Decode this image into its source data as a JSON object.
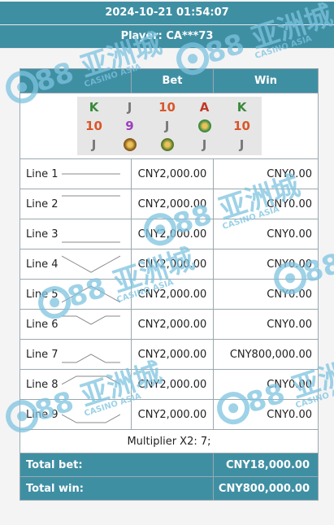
{
  "header": {
    "datetime": "2024-10-21 01:54:07",
    "player": "Player: CA***73"
  },
  "watermark": {
    "brand_text": "88 亚洲城",
    "sub_text": "CASINO ASIA",
    "color": "#7ec3e0"
  },
  "columns": {
    "line": "",
    "bet": "Bet",
    "win": "Win"
  },
  "reels": [
    [
      {
        "glyph": "K",
        "color": "#3a8a3a"
      },
      {
        "glyph": "10",
        "color": "#d9562a"
      },
      {
        "glyph": "J",
        "color": "#777777"
      }
    ],
    [
      {
        "glyph": "J",
        "color": "#777777"
      },
      {
        "glyph": "9",
        "color": "#9c3fbf"
      },
      {
        "glyph": "coin",
        "color": "#8a5a1a"
      }
    ],
    [
      {
        "glyph": "10",
        "color": "#d9562a"
      },
      {
        "glyph": "J",
        "color": "#777777"
      },
      {
        "glyph": "coin",
        "color": "#5a7a2a"
      }
    ],
    [
      {
        "glyph": "A",
        "color": "#c0392b"
      },
      {
        "glyph": "coin",
        "color": "#3f8a3f"
      },
      {
        "glyph": "J",
        "color": "#777777"
      }
    ],
    [
      {
        "glyph": "K",
        "color": "#3a8a3a"
      },
      {
        "glyph": "10",
        "color": "#d9562a"
      },
      {
        "glyph": "J",
        "color": "#777777"
      }
    ]
  ],
  "lines": [
    {
      "name": "Line 1",
      "pattern": [
        1,
        1,
        1,
        1,
        1
      ],
      "bet": "CNY2,000.00",
      "win": "CNY0.00"
    },
    {
      "name": "Line 2",
      "pattern": [
        0,
        0,
        0,
        0,
        0
      ],
      "bet": "CNY2,000.00",
      "win": "CNY0.00"
    },
    {
      "name": "Line 3",
      "pattern": [
        2,
        2,
        2,
        2,
        2
      ],
      "bet": "CNY2,000.00",
      "win": "CNY0.00"
    },
    {
      "name": "Line 4",
      "pattern": [
        0,
        1,
        2,
        1,
        0
      ],
      "bet": "CNY2,000.00",
      "win": "CNY0.00"
    },
    {
      "name": "Line 5",
      "pattern": [
        2,
        1,
        0,
        1,
        2
      ],
      "bet": "CNY2,000.00",
      "win": "CNY0.00"
    },
    {
      "name": "Line 6",
      "pattern": [
        0,
        0,
        1,
        0,
        0
      ],
      "bet": "CNY2,000.00",
      "win": "CNY0.00"
    },
    {
      "name": "Line 7",
      "pattern": [
        2,
        2,
        1,
        2,
        2
      ],
      "bet": "CNY2,000.00",
      "win": "CNY800,000.00"
    },
    {
      "name": "Line 8",
      "pattern": [
        1,
        0,
        0,
        0,
        1
      ],
      "bet": "CNY2,000.00",
      "win": "CNY0.00"
    },
    {
      "name": "Line 9",
      "pattern": [
        1,
        2,
        2,
        2,
        1
      ],
      "bet": "CNY2,000.00",
      "win": "CNY0.00"
    }
  ],
  "multiplier": "Multiplier X2: 7;",
  "totals": {
    "bet_label": "Total bet:",
    "bet_value": "CNY18,000.00",
    "win_label": "Total win:",
    "win_value": "CNY800,000.00"
  }
}
